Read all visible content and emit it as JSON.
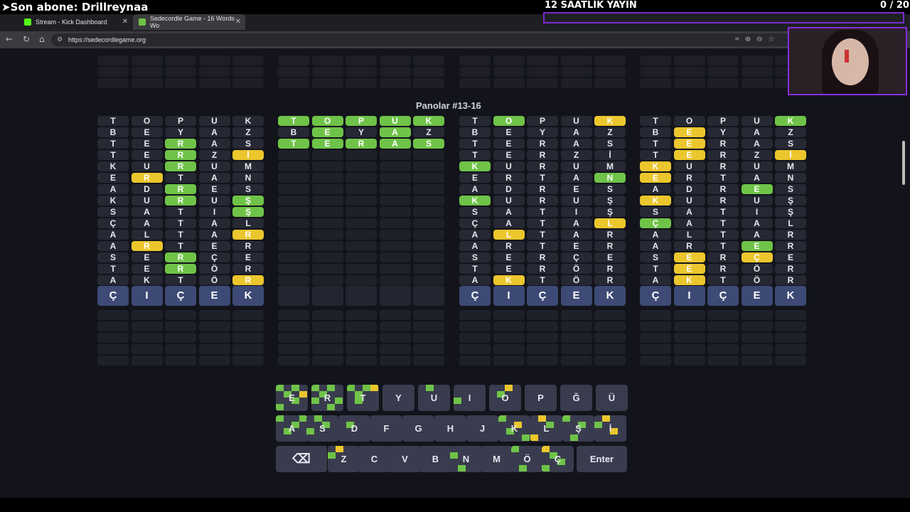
{
  "overlay": {
    "subscriber": "➤Son abone: Drillreynaa",
    "stream_title": "12 SAATLİK YAYIN",
    "counter": "0 / 20"
  },
  "browser": {
    "tabs": [
      {
        "label": "Stream - Kick Dashboard",
        "icon": "kick-icon",
        "color": "#53fc18"
      },
      {
        "label": "Sedecordle Game - 16 Words Wo",
        "icon": "sedecordle-icon",
        "color": "#6fc348"
      }
    ],
    "url": "https://sedecordlegame.org"
  },
  "game": {
    "title": "Panolar #13-16",
    "guess": [
      "Ç",
      "I",
      "Ç",
      "E",
      "K"
    ],
    "boards": [
      {
        "rows": [
          [
            "T",
            "O",
            "P",
            "U",
            "K"
          ],
          [
            "B",
            "E",
            "Y",
            "A",
            "Z"
          ],
          [
            "T",
            "E",
            "R",
            "A",
            "S"
          ],
          [
            "T",
            "E",
            "R",
            "Z",
            "İ"
          ],
          [
            "K",
            "U",
            "R",
            "U",
            "M"
          ],
          [
            "E",
            "R",
            "T",
            "A",
            "N"
          ],
          [
            "A",
            "D",
            "R",
            "E",
            "S"
          ],
          [
            "K",
            "U",
            "R",
            "U",
            "Ş"
          ],
          [
            "S",
            "A",
            "T",
            "I",
            "Ş"
          ],
          [
            "Ç",
            "A",
            "T",
            "A",
            "L"
          ],
          [
            "A",
            "L",
            "T",
            "A",
            "R"
          ],
          [
            "A",
            "R",
            "T",
            "E",
            "R"
          ],
          [
            "S",
            "E",
            "R",
            "Ç",
            "E"
          ],
          [
            "T",
            "E",
            "R",
            "Ö",
            "R"
          ],
          [
            "A",
            "K",
            "T",
            "Ö",
            "R"
          ]
        ],
        "colors": [
          "_____",
          "_____",
          "__g__",
          "__g_y",
          "__g__",
          "_y___",
          "__g__",
          "__g_g",
          "____g",
          "_____",
          "____y",
          "_y___",
          "__g__",
          "__g__",
          "____y"
        ],
        "guess": true
      },
      {
        "rows": [
          [
            "T",
            "O",
            "P",
            "U",
            "K"
          ],
          [
            "B",
            "E",
            "Y",
            "A",
            "Z"
          ],
          [
            "T",
            "E",
            "R",
            "A",
            "S"
          ]
        ],
        "colors": [
          "ggggg",
          "_g_g_",
          "ggggg"
        ],
        "guess": false
      },
      {
        "rows": [
          [
            "T",
            "O",
            "P",
            "U",
            "K"
          ],
          [
            "B",
            "E",
            "Y",
            "A",
            "Z"
          ],
          [
            "T",
            "E",
            "R",
            "A",
            "S"
          ],
          [
            "T",
            "E",
            "R",
            "Z",
            "İ"
          ],
          [
            "K",
            "U",
            "R",
            "U",
            "M"
          ],
          [
            "E",
            "R",
            "T",
            "A",
            "N"
          ],
          [
            "A",
            "D",
            "R",
            "E",
            "S"
          ],
          [
            "K",
            "U",
            "R",
            "U",
            "Ş"
          ],
          [
            "S",
            "A",
            "T",
            "I",
            "Ş"
          ],
          [
            "Ç",
            "A",
            "T",
            "A",
            "L"
          ],
          [
            "A",
            "L",
            "T",
            "A",
            "R"
          ],
          [
            "A",
            "R",
            "T",
            "E",
            "R"
          ],
          [
            "S",
            "E",
            "R",
            "Ç",
            "E"
          ],
          [
            "T",
            "E",
            "R",
            "Ö",
            "R"
          ],
          [
            "A",
            "K",
            "T",
            "Ö",
            "R"
          ]
        ],
        "colors": [
          "_g__y",
          "_____",
          "_____",
          "_____",
          "g____",
          "____g",
          "_____",
          "g____",
          "_____",
          "____y",
          "_y___",
          "_____",
          "_____",
          "_____",
          "_y___"
        ],
        "guess": true
      },
      {
        "rows": [
          [
            "T",
            "O",
            "P",
            "U",
            "K"
          ],
          [
            "B",
            "E",
            "Y",
            "A",
            "Z"
          ],
          [
            "T",
            "E",
            "R",
            "A",
            "S"
          ],
          [
            "T",
            "E",
            "R",
            "Z",
            "İ"
          ],
          [
            "K",
            "U",
            "R",
            "U",
            "M"
          ],
          [
            "E",
            "R",
            "T",
            "A",
            "N"
          ],
          [
            "A",
            "D",
            "R",
            "E",
            "S"
          ],
          [
            "K",
            "U",
            "R",
            "U",
            "Ş"
          ],
          [
            "S",
            "A",
            "T",
            "I",
            "Ş"
          ],
          [
            "Ç",
            "A",
            "T",
            "A",
            "L"
          ],
          [
            "A",
            "L",
            "T",
            "A",
            "R"
          ],
          [
            "A",
            "R",
            "T",
            "E",
            "R"
          ],
          [
            "S",
            "E",
            "R",
            "Ç",
            "E"
          ],
          [
            "T",
            "E",
            "R",
            "Ö",
            "R"
          ],
          [
            "A",
            "K",
            "T",
            "Ö",
            "R"
          ]
        ],
        "colors": [
          "____g",
          "_y___",
          "_y___",
          "_y__y",
          "y____",
          "y____",
          "___g_",
          "y____",
          "_____",
          "g____",
          "_____",
          "___g_",
          "_y_y_",
          "_y___",
          "_y___"
        ],
        "guess": true
      }
    ]
  },
  "keyboard": {
    "rows": [
      [
        "E",
        "R",
        "T",
        "Y",
        "U",
        "I",
        "O",
        "P",
        "Ğ",
        "Ü"
      ],
      [
        "A",
        "S",
        "D",
        "F",
        "G",
        "H",
        "J",
        "K",
        "L",
        "Ş",
        "İ"
      ],
      [
        "⌫",
        "Z",
        "C",
        "V",
        "B",
        "N",
        "M",
        "Ö",
        "Ç",
        "Enter"
      ]
    ],
    "backspace_icon": "backspace-icon"
  }
}
